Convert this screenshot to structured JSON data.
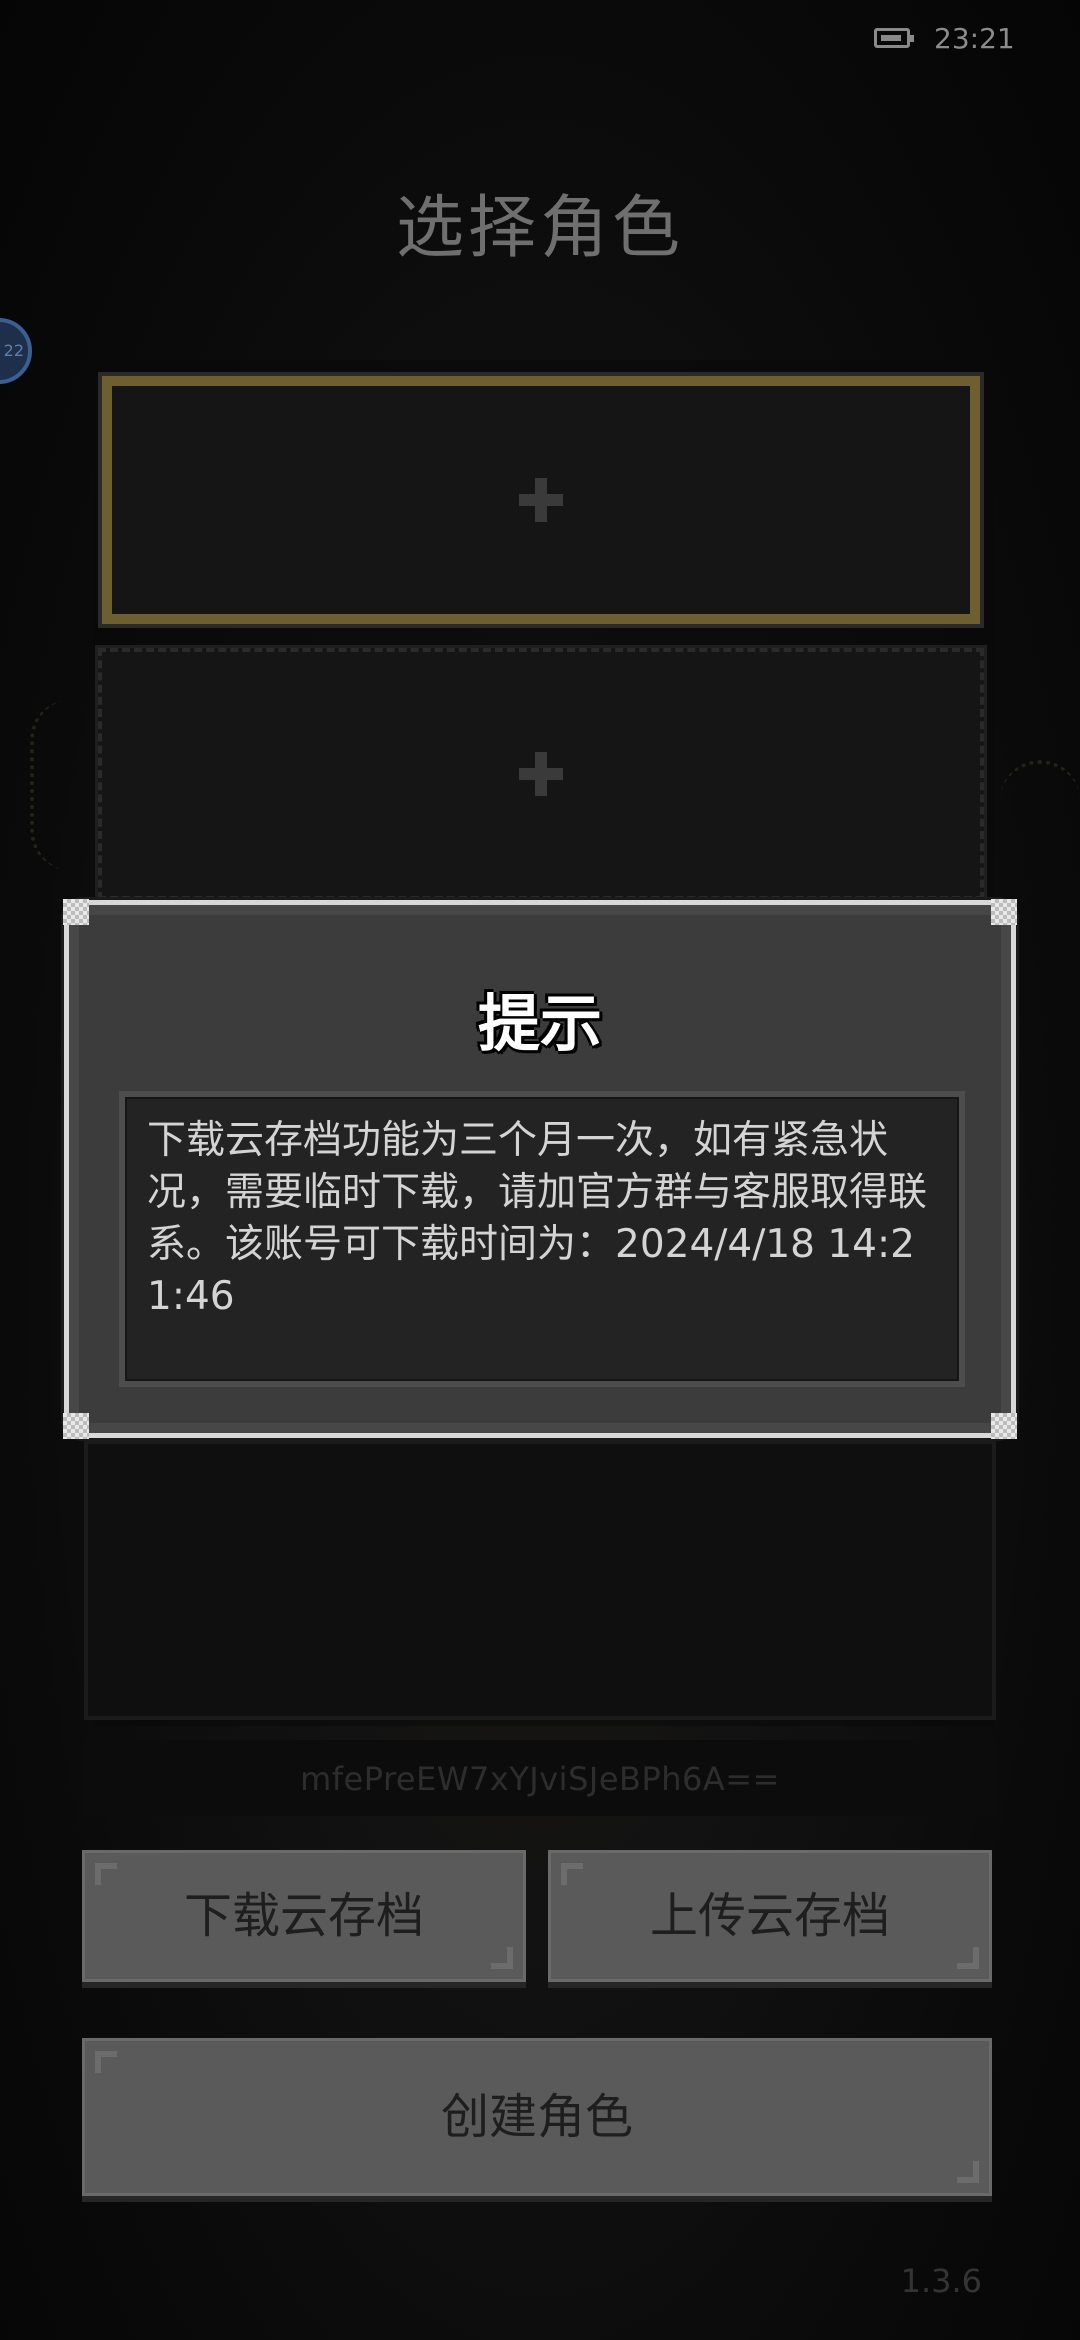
{
  "status_bar": {
    "time": "23:21",
    "battery_icon": "battery-icon"
  },
  "title": "选择角色",
  "side_avatar": {
    "badge": "22"
  },
  "slots": [
    {
      "icon": "plus-icon",
      "selected": true
    },
    {
      "icon": "plus-icon",
      "selected": false
    },
    {
      "icon": "",
      "selected": false
    }
  ],
  "account_id": "mfePreEW7xYJviSJeBPh6A==",
  "buttons": {
    "download_cloud_save": "下载云存档",
    "upload_cloud_save": "上传云存档",
    "create_character": "创建角色"
  },
  "version": "1.3.6",
  "dialog": {
    "title": "提示",
    "message": "下载云存档功能为三个月一次，如有紧急状况，需要临时下载，请加官方群与客服取得联系。该账号可下载时间为：2024/4/18 14:21:46"
  },
  "colors": {
    "selected_slot_border": "#6e5f30",
    "dialog_border": "#d8d8d8",
    "button_bg": "#5a5a5a"
  }
}
